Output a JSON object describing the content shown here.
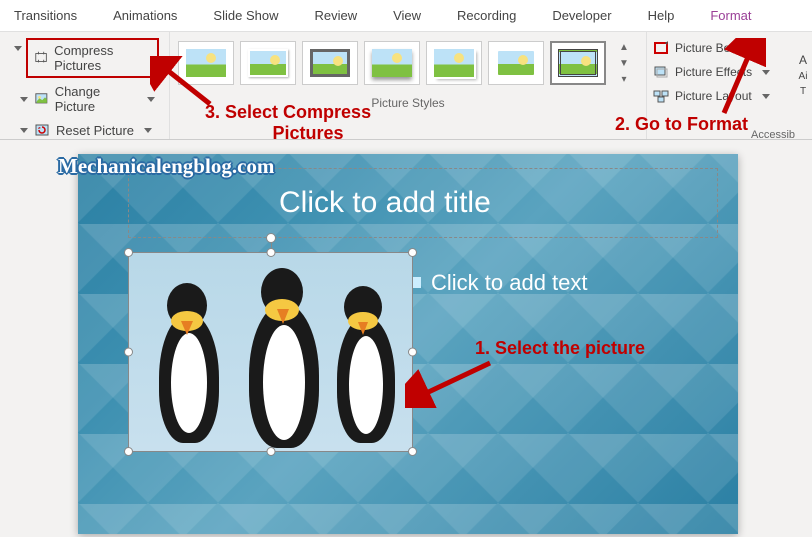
{
  "tabs": [
    "Transitions",
    "Animations",
    "Slide Show",
    "Review",
    "View",
    "Recording",
    "Developer",
    "Help",
    "Format"
  ],
  "active_tab_index": 8,
  "adjust": {
    "compress": "Compress Pictures",
    "change": "Change Picture",
    "reset": "Reset Picture"
  },
  "picture_styles_label": "Picture Styles",
  "picture_options": {
    "border": "Picture Bord",
    "effects": "Picture Effects",
    "layout": "Picture Layout"
  },
  "right_edge": {
    "line1": "A",
    "line2": "Ai",
    "line3": "T",
    "group": "Accessib"
  },
  "slide": {
    "title_placeholder": "Click to add title",
    "body_placeholder": "Click to add text"
  },
  "annotations": {
    "step1": "1.  Select the picture",
    "step2": "2. Go to Format",
    "step3a": "3. Select Compress",
    "step3b": "Pictures"
  },
  "watermark": "Mechanicalengblog.com"
}
